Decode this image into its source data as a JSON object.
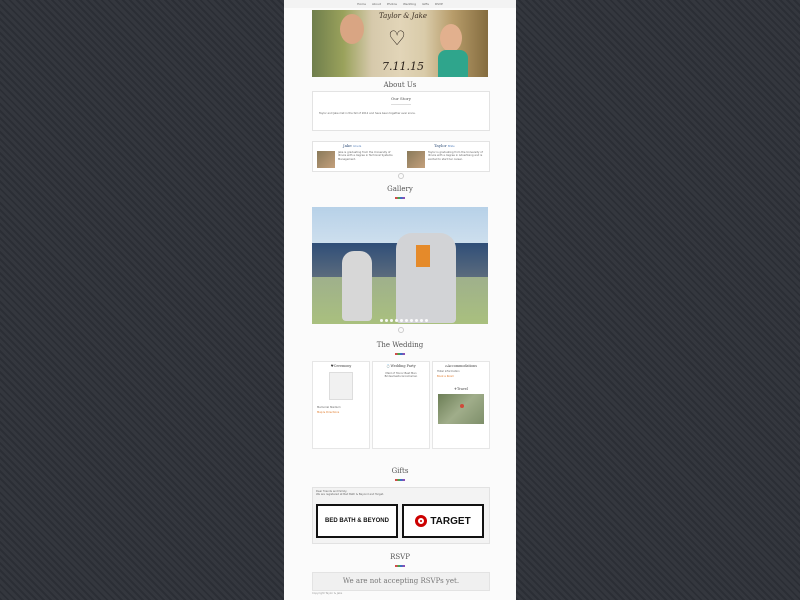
{
  "nav": {
    "items": [
      "Home",
      "About",
      "Photos",
      "Wedding",
      "Gifts",
      "RSVP"
    ]
  },
  "hero": {
    "names": "Taylor & Jake",
    "date": "7.11.15"
  },
  "about": {
    "title": "About Us",
    "story_title": "Our Story",
    "story_text": "Taylor and Jake met in the fall of 2012 and have been together ever since.",
    "people": [
      {
        "name": "Jake",
        "subtitle": "Groom",
        "bio": "Jake is graduating from the University of Illinois with a degree in Technical Systems Management."
      },
      {
        "name": "Taylor",
        "subtitle": "Bride",
        "bio": "Taylor is graduating from the University of Illinois with a degree in Advertising and is excited to start her career."
      }
    ]
  },
  "gallery": {
    "title": "Gallery"
  },
  "wedding": {
    "title": "The Wedding",
    "cards": [
      {
        "heading": "Ceremony",
        "address": "Memorial Stadium",
        "link": "Map & Directions"
      },
      {
        "heading": "Wedding Party",
        "text": "Maid of Honor  Best Man  Bridesmaids  Groomsmen"
      },
      {
        "heading": "Accommodations",
        "text": "Hotel information",
        "link": "Book a Room",
        "travel_heading": "Travel"
      }
    ]
  },
  "gifts": {
    "title": "Gifts",
    "intro": "Dear friends and family,",
    "registry_note": "We are registered at Bed Bath & Beyond and Target.",
    "logos": [
      "BED BATH & BEYOND",
      "TARGET"
    ]
  },
  "rsvp": {
    "title": "RSVP",
    "message": "We are not accepting RSVPs yet."
  },
  "footer": {
    "text": "Copyright Taylor & Jake"
  },
  "colors": {
    "accent": "#e07a2a",
    "background": "#2e3138",
    "page": "#fbfbfb"
  }
}
